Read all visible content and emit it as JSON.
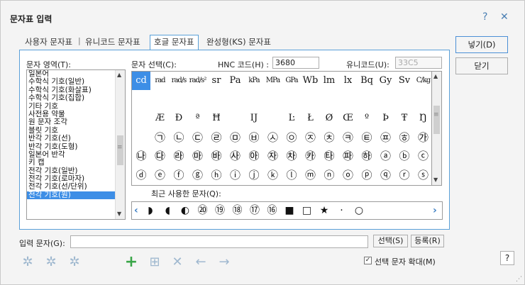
{
  "window": {
    "title": "문자표 입력",
    "help_glyph": "?",
    "close_glyph": "✕"
  },
  "tabs": [
    "사용자 문자표",
    "유니코드 문자표",
    "호글 문자표",
    "완성형(KS) 문자표"
  ],
  "tab_separator": "|",
  "region": {
    "label": "문자 영역(T):",
    "items": [
      "일본어",
      "수학식 기호(일반)",
      "수학식 기호(화살표)",
      "수학식 기호(집합)",
      "기타 기호",
      "사전용 약물",
      "원 문자 조각",
      "블릿 기호",
      "반각 기호(선)",
      "반각 기호(도형)",
      "일본어 반각",
      "키 캡",
      "전각 기호(일반)",
      "전각 기호(로마자)",
      "전각 기호(선/단위)",
      "전각 기호(원)"
    ],
    "selected_index": 15
  },
  "select": {
    "label": "문자 선택(C):",
    "hnc_label": "HNC 코드(H) :",
    "hnc_value": "3680",
    "unicode_label": "유니코드(U):",
    "unicode_value": "33C5"
  },
  "grid": {
    "rows": [
      [
        "cd",
        "rad",
        "rad/s",
        "rad/s²",
        "sr",
        "Pa",
        "kPa",
        "MPa",
        "GPa",
        "Wb",
        "lm",
        "lx",
        "Bq",
        "Gy",
        "Sv",
        "C/kg"
      ],
      [
        "",
        "",
        "",
        "",
        "",
        "",
        "",
        "",
        "",
        "",
        "",
        "",
        "",
        "",
        "",
        ""
      ],
      [
        "",
        "Æ",
        "Đ",
        "ª",
        "Ħ",
        "",
        "Ĳ",
        "",
        "Ŀ",
        "Ł",
        "Ø",
        "Œ",
        "º",
        "Þ",
        "Ŧ",
        "Ŋ"
      ],
      [
        "",
        "㉠",
        "㉡",
        "㉢",
        "㉣",
        "㉤",
        "㉥",
        "㉦",
        "㉧",
        "㉨",
        "㉩",
        "㉪",
        "㉫",
        "㉬",
        "㉭",
        "㉮"
      ],
      [
        "㉯",
        "㉰",
        "㉱",
        "㉲",
        "㉳",
        "㉴",
        "㉵",
        "㉶",
        "㉷",
        "㉸",
        "㉹",
        "㉺",
        "㉻",
        "ⓐ",
        "ⓑ",
        "ⓒ"
      ],
      [
        "ⓓ",
        "ⓔ",
        "ⓕ",
        "ⓖ",
        "ⓗ",
        "ⓘ",
        "ⓙ",
        "ⓚ",
        "ⓛ",
        "ⓜ",
        "ⓝ",
        "ⓞ",
        "ⓟ",
        "ⓠ",
        "ⓡ",
        "ⓢ"
      ]
    ],
    "selected_cell": "cd"
  },
  "recent": {
    "label": "최근 사용한 문자(Q):",
    "items": [
      "◗",
      "◖",
      "◐",
      "⑳",
      "⑲",
      "⑱",
      "⑰",
      "⑯",
      "■",
      "□",
      "★",
      "·",
      "○"
    ]
  },
  "input": {
    "label": "입력 문자(G):",
    "value": ""
  },
  "buttons": {
    "insert": "넣기(D)",
    "close": "닫기",
    "select": "선택(S)",
    "register": "등록(R)"
  },
  "toolbar_icons": [
    "add-icon",
    "add-to-icon",
    "delete-icon",
    "move-left-icon",
    "move-right-icon"
  ],
  "enlarge": {
    "label": "선택 문자 확대(M)",
    "checked": true
  },
  "colors": {
    "accent": "#3d8ee6",
    "frame": "#5aa0d8",
    "add_green": "#3aa648"
  }
}
